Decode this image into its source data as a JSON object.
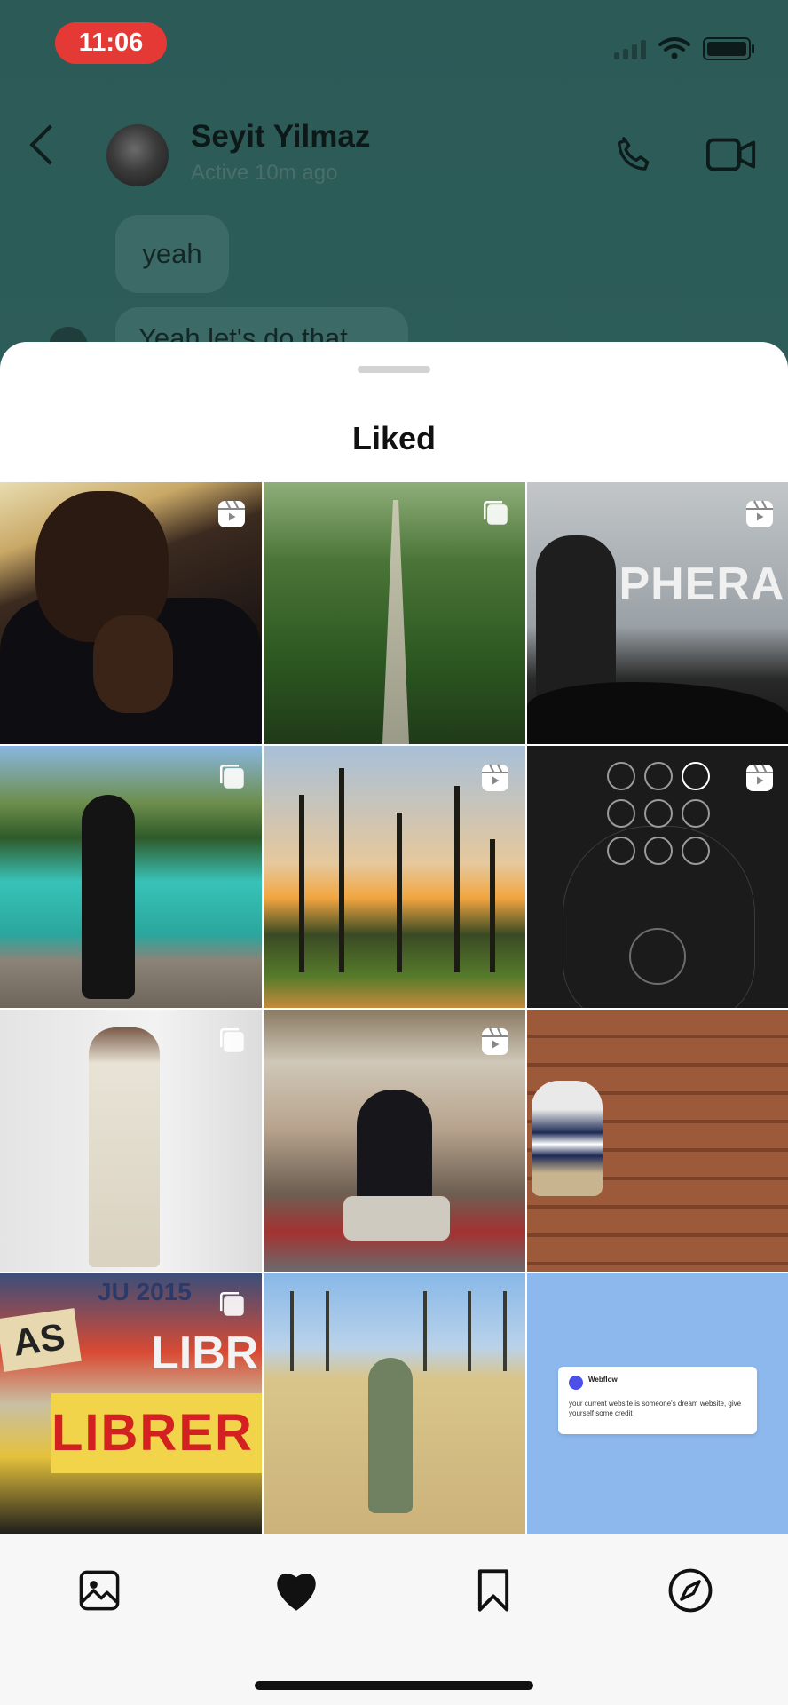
{
  "status_bar": {
    "time": "11:06"
  },
  "chat_header": {
    "name": "Seyit Yilmaz",
    "status": "Active 10m ago"
  },
  "messages": [
    {
      "text": "yeah"
    },
    {
      "text": "Yeah let's do that"
    }
  ],
  "sheet": {
    "title": "Liked"
  },
  "grid": {
    "tiles": [
      {
        "kind": "reel"
      },
      {
        "kind": "post"
      },
      {
        "kind": "reel",
        "overlay_text": "IPHERAL"
      },
      {
        "kind": "post"
      },
      {
        "kind": "reel"
      },
      {
        "kind": "reel"
      },
      {
        "kind": "post"
      },
      {
        "kind": "reel"
      },
      {
        "kind": "post"
      },
      {
        "kind": "post",
        "signs": [
          "JU 2015",
          "AS",
          "LIBR",
          "LIBRER"
        ]
      },
      {
        "kind": "post"
      },
      {
        "kind": "ad",
        "brand": "Webflow",
        "text": "your current website is someone's dream website, give yourself some credit"
      }
    ]
  },
  "tabbar": {
    "items": [
      {
        "name": "gallery-icon"
      },
      {
        "name": "heart-icon",
        "active": true
      },
      {
        "name": "bookmark-icon"
      },
      {
        "name": "compass-icon"
      }
    ]
  },
  "colors": {
    "status_pill": "#e53935",
    "chat_background": "#2e5a57",
    "sheet_background": "#ffffff",
    "tabbar_background": "#f7f7f7"
  }
}
